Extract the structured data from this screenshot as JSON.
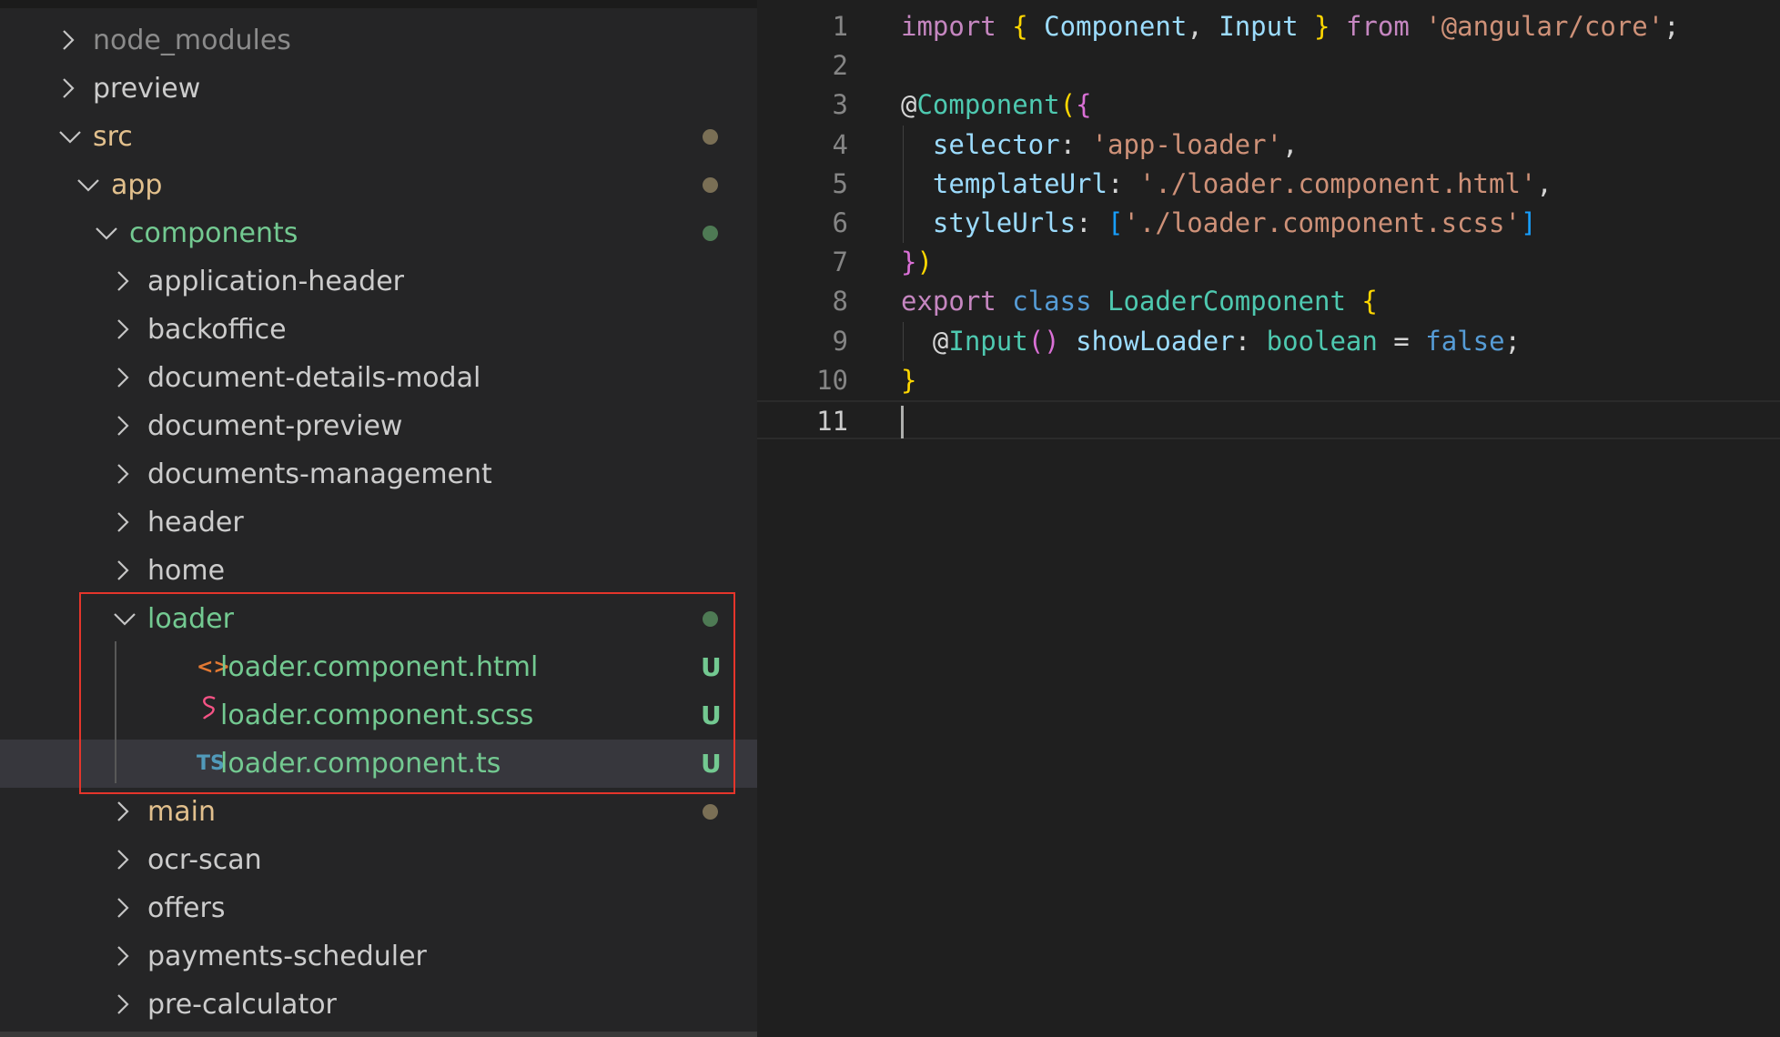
{
  "colors": {
    "git_untracked": "#73c991",
    "modified_folder": "#e2c08d",
    "default_text": "#cccccc",
    "dot_olive": "#7a6f55",
    "dot_green": "#4e7a54",
    "highlight_border": "#e5352b",
    "html_icon": "#e37933",
    "scss_icon": "#f55385",
    "ts_icon": "#519aba"
  },
  "explorer": {
    "items": [
      {
        "label": "node_modules",
        "expanded": false,
        "depth": 0,
        "color": "#8b8b8b"
      },
      {
        "label": "preview",
        "expanded": false,
        "depth": 0,
        "color": "#cccccc"
      },
      {
        "label": "src",
        "expanded": true,
        "depth": 0,
        "color": "#e2c08d",
        "dot": "#7a6f55"
      },
      {
        "label": "app",
        "expanded": true,
        "depth": 1,
        "color": "#e2c08d",
        "dot": "#7a6f55"
      },
      {
        "label": "components",
        "expanded": true,
        "depth": 2,
        "color": "#73c991",
        "dot": "#4e7a54"
      },
      {
        "label": "application-header",
        "expanded": false,
        "depth": 3,
        "color": "#cccccc"
      },
      {
        "label": "backoffice",
        "expanded": false,
        "depth": 3,
        "color": "#cccccc"
      },
      {
        "label": "document-details-modal",
        "expanded": false,
        "depth": 3,
        "color": "#cccccc"
      },
      {
        "label": "document-preview",
        "expanded": false,
        "depth": 3,
        "color": "#cccccc"
      },
      {
        "label": "documents-management",
        "expanded": false,
        "depth": 3,
        "color": "#cccccc"
      },
      {
        "label": "header",
        "expanded": false,
        "depth": 3,
        "color": "#cccccc"
      },
      {
        "label": "home",
        "expanded": false,
        "depth": 3,
        "color": "#cccccc"
      },
      {
        "label": "loader",
        "expanded": true,
        "depth": 3,
        "color": "#73c991",
        "dot": "#4e7a54"
      },
      {
        "label": "loader.component.html",
        "file": "html",
        "depth": 4,
        "color": "#73c991",
        "badge": "U",
        "icon_text": "<>",
        "icon_name": "html-file-icon"
      },
      {
        "label": "loader.component.scss",
        "file": "scss",
        "depth": 4,
        "color": "#73c991",
        "badge": "U",
        "icon_name": "sass-file-icon"
      },
      {
        "label": "loader.component.ts",
        "file": "ts",
        "depth": 4,
        "color": "#73c991",
        "badge": "U",
        "icon_text": "TS",
        "icon_name": "typescript-file-icon",
        "selected": true
      },
      {
        "label": "main",
        "expanded": false,
        "depth": 3,
        "color": "#e2c08d",
        "dot": "#7a6f55"
      },
      {
        "label": "ocr-scan",
        "expanded": false,
        "depth": 3,
        "color": "#cccccc"
      },
      {
        "label": "offers",
        "expanded": false,
        "depth": 3,
        "color": "#cccccc"
      },
      {
        "label": "payments-scheduler",
        "expanded": false,
        "depth": 3,
        "color": "#cccccc"
      },
      {
        "label": "pre-calculator",
        "expanded": false,
        "depth": 3,
        "color": "#cccccc"
      }
    ]
  },
  "editor": {
    "active_line": 11,
    "lines": [
      {
        "num": "1",
        "tokens": [
          [
            "kw",
            "import"
          ],
          [
            "plain",
            " "
          ],
          [
            "br1",
            "{"
          ],
          [
            "plain",
            " "
          ],
          [
            "var",
            "Component"
          ],
          [
            "plain",
            ", "
          ],
          [
            "var",
            "Input"
          ],
          [
            "plain",
            " "
          ],
          [
            "br1",
            "}"
          ],
          [
            "plain",
            " "
          ],
          [
            "kw",
            "from"
          ],
          [
            "plain",
            " "
          ],
          [
            "str",
            "'@angular/core'"
          ],
          [
            "plain",
            ";"
          ]
        ]
      },
      {
        "num": "2",
        "tokens": []
      },
      {
        "num": "3",
        "tokens": [
          [
            "plain",
            "@"
          ],
          [
            "fn",
            "Component"
          ],
          [
            "br1",
            "("
          ],
          [
            "br2",
            "{"
          ]
        ]
      },
      {
        "num": "4",
        "indent": true,
        "tokens": [
          [
            "plain",
            "  "
          ],
          [
            "var",
            "selector"
          ],
          [
            "plain",
            ": "
          ],
          [
            "str",
            "'app-loader'"
          ],
          [
            "plain",
            ","
          ]
        ]
      },
      {
        "num": "5",
        "indent": true,
        "tokens": [
          [
            "plain",
            "  "
          ],
          [
            "var",
            "templateUrl"
          ],
          [
            "plain",
            ": "
          ],
          [
            "str",
            "'./loader.component.html'"
          ],
          [
            "plain",
            ","
          ]
        ]
      },
      {
        "num": "6",
        "indent": true,
        "tokens": [
          [
            "plain",
            "  "
          ],
          [
            "var",
            "styleUrls"
          ],
          [
            "plain",
            ": "
          ],
          [
            "br3",
            "["
          ],
          [
            "str",
            "'./loader.component.scss'"
          ],
          [
            "br3",
            "]"
          ]
        ]
      },
      {
        "num": "7",
        "tokens": [
          [
            "br2",
            "}"
          ],
          [
            "br1",
            ")"
          ]
        ]
      },
      {
        "num": "8",
        "tokens": [
          [
            "kw",
            "export"
          ],
          [
            "plain",
            " "
          ],
          [
            "sto",
            "class"
          ],
          [
            "plain",
            " "
          ],
          [
            "fnc",
            "LoaderComponent"
          ],
          [
            "plain",
            " "
          ],
          [
            "br1",
            "{"
          ]
        ]
      },
      {
        "num": "9",
        "indent": true,
        "tokens": [
          [
            "plain",
            "  @"
          ],
          [
            "fn",
            "Input"
          ],
          [
            "br2",
            "()"
          ],
          [
            "plain",
            " "
          ],
          [
            "var",
            "showLoader"
          ],
          [
            "plain",
            ": "
          ],
          [
            "fnc",
            "boolean"
          ],
          [
            "plain",
            " = "
          ],
          [
            "sto",
            "false"
          ],
          [
            "plain",
            ";"
          ]
        ]
      },
      {
        "num": "10",
        "tokens": [
          [
            "br1",
            "}"
          ]
        ]
      },
      {
        "num": "11",
        "tokens": []
      }
    ]
  }
}
